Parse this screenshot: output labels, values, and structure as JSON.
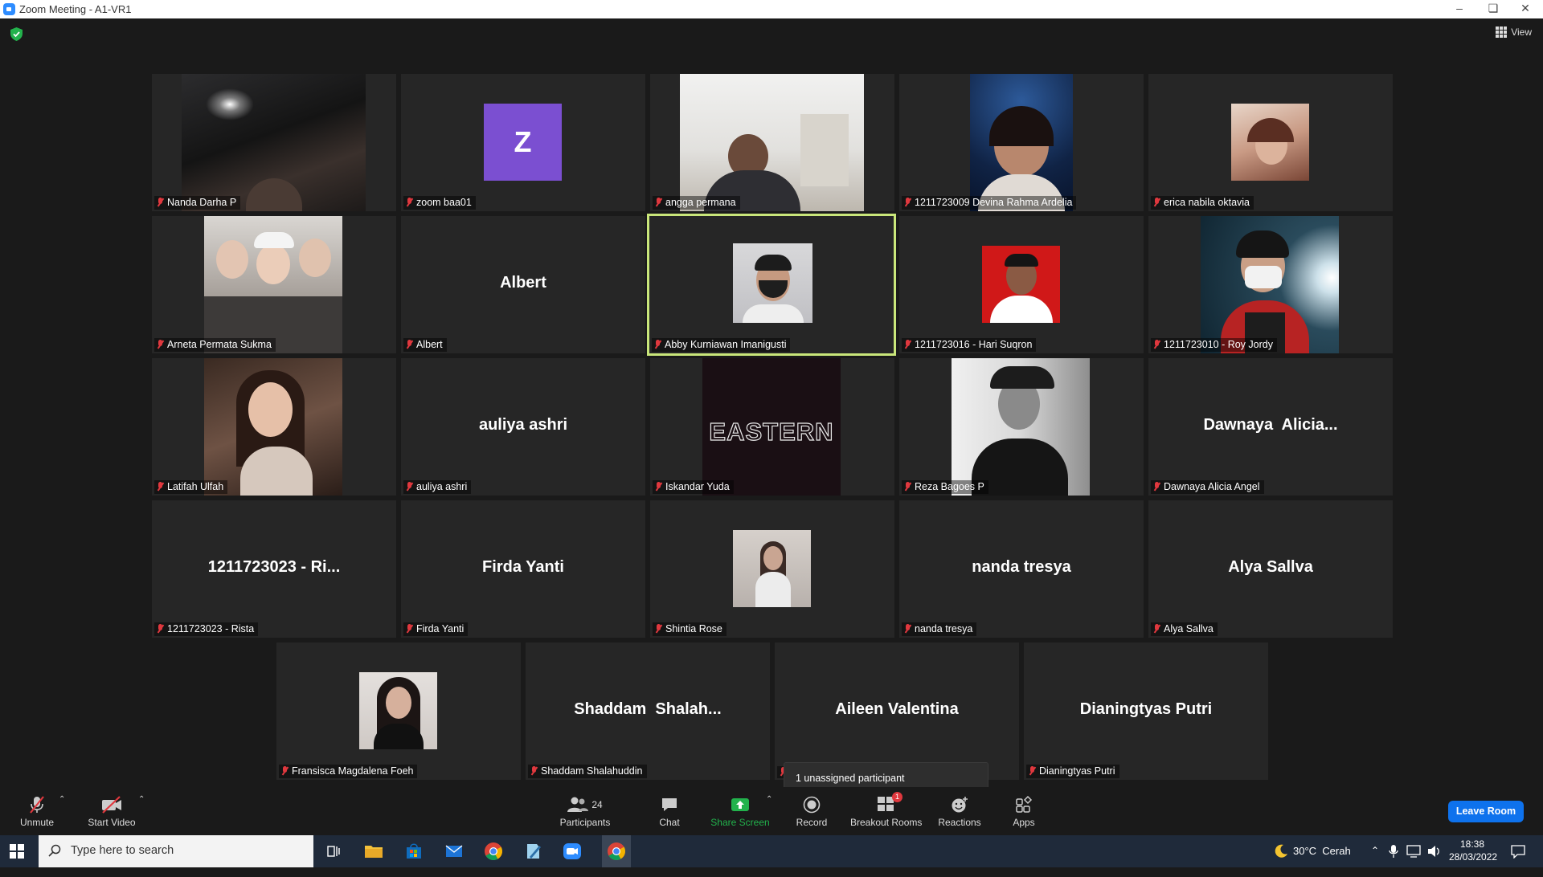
{
  "window": {
    "title": "Zoom Meeting - A1-VR1"
  },
  "header": {
    "view_label": "View"
  },
  "tiles": [
    {
      "label": "Nanda Darha P"
    },
    {
      "label": "zoom baa01",
      "avatar_letter": "Z"
    },
    {
      "label": "angga permana"
    },
    {
      "label": "1211723009 Devina Rahma Ardelia"
    },
    {
      "label": "erica nabila oktavia"
    },
    {
      "label": "Arneta Permata Sukma"
    },
    {
      "label": "Albert",
      "big": "Albert"
    },
    {
      "label": "Abby Kurniawan Imanigusti"
    },
    {
      "label": "1211723016 - Hari Suqron"
    },
    {
      "label": "1211723010 - Roy Jordy"
    },
    {
      "label": "Latifah Ulfah"
    },
    {
      "label": "auliya ashri",
      "big": "auliya ashri"
    },
    {
      "label": "Iskandar Yuda",
      "logo_text": "EASTERN"
    },
    {
      "label": "Reza Bagoes P"
    },
    {
      "label": "Dawnaya Alicia Angel",
      "big": "Dawnaya  Alicia..."
    },
    {
      "label": "1211723023 - Rista",
      "big": "1211723023 - Ri..."
    },
    {
      "label": "Firda Yanti",
      "big": "Firda Yanti"
    },
    {
      "label": "Shintia Rose"
    },
    {
      "label": "nanda tresya",
      "big": "nanda tresya"
    },
    {
      "label": "Alya Sallva",
      "big": "Alya Sallva"
    },
    {
      "label": "Fransisca Magdalena Foeh"
    },
    {
      "label": "Shaddam Shalahuddin",
      "big": "Shaddam  Shalah..."
    },
    {
      "label": "",
      "big": "Aileen Valentina"
    },
    {
      "label": "Dianingtyas Putri",
      "big": "Dianingtyas Putri"
    }
  ],
  "popup": {
    "text": "1 unassigned participant"
  },
  "toolbar": {
    "unmute": "Unmute",
    "start_video": "Start Video",
    "participants": "Participants",
    "participants_count": "24",
    "chat": "Chat",
    "share_screen": "Share Screen",
    "record": "Record",
    "breakout_rooms": "Breakout Rooms",
    "breakout_badge": "1",
    "reactions": "Reactions",
    "apps": "Apps",
    "leave": "Leave Room"
  },
  "taskbar": {
    "search_placeholder": "Type here to search",
    "weather": "30°C  Cerah",
    "time": "18:38",
    "date": "28/03/2022"
  },
  "colors": {
    "accent": "#0e72ed",
    "active_speaker": "#c9e67a",
    "muted": "#e0383e",
    "share": "#22b24c"
  }
}
